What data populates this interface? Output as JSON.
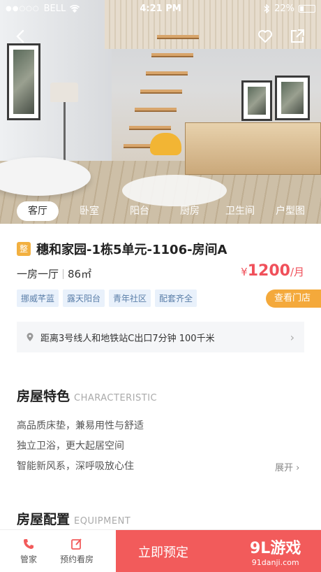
{
  "status": {
    "carrier": "BELL",
    "time": "4:21 PM",
    "battery": "22%"
  },
  "gallery": {
    "tabs": [
      "客厅",
      "卧室",
      "阳台",
      "厨房",
      "卫生间",
      "户型图"
    ],
    "active_tab": "客厅"
  },
  "listing": {
    "badge": "整",
    "title": "穗和家园-1栋5单元-1106-房间A",
    "layout": "一房一厅",
    "area": "86㎡",
    "price_symbol": "¥",
    "price": "1200",
    "price_unit": "/月",
    "tags": [
      "挪威芊蓝",
      "露天阳台",
      "青年社区",
      "配套齐全"
    ],
    "store_button": "查看门店",
    "location": "距离3号线人和地铁站C出口7分钟 100千米"
  },
  "characteristic": {
    "title": "房屋特色",
    "subtitle": "CHARACTERISTIC",
    "items": [
      "高品质床垫，兼易用性与舒适",
      "独立卫浴，更大起居空间",
      "智能新风系，深呼吸放心住"
    ],
    "expand": "展开"
  },
  "equipment": {
    "title": "房屋配置",
    "subtitle": "EQUIPMENT"
  },
  "bottom": {
    "steward": "管家",
    "appointment": "预约看房",
    "book": "立即预定"
  },
  "watermark": {
    "text": "9L游戏",
    "url": "91danji.com"
  },
  "colors": {
    "accent": "#f25b5b",
    "price": "#f0505a",
    "orange": "#f4a93b",
    "tag_bg": "#e9f1fb"
  }
}
